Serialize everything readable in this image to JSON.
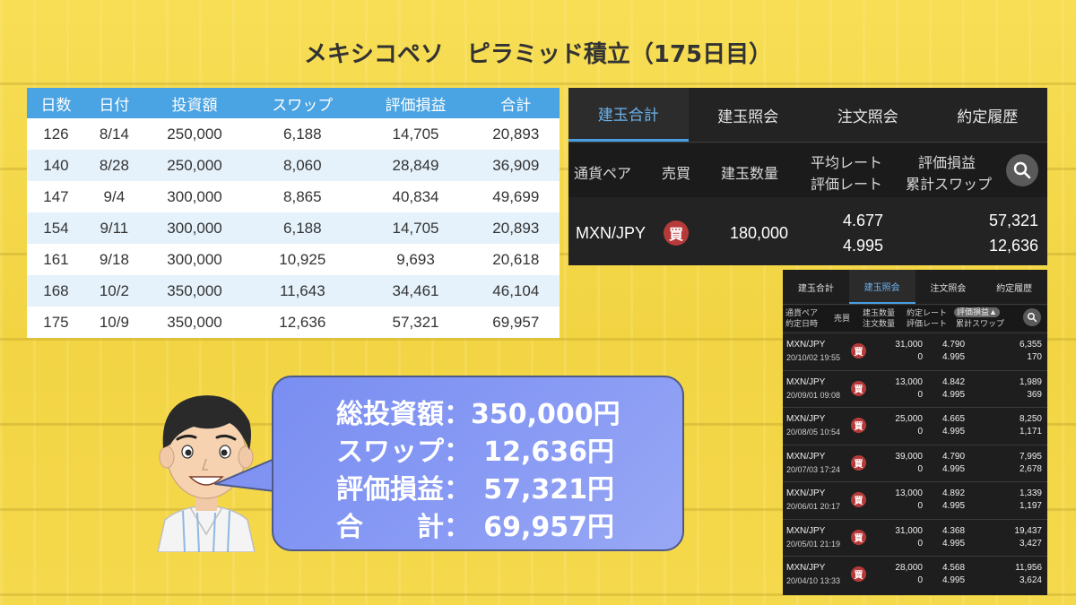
{
  "title": "メキシコペソ　ピラミッド積立（175日目）",
  "summary_table": {
    "headers": [
      "日数",
      "日付",
      "投資額",
      "スワップ",
      "評価損益",
      "合計"
    ],
    "rows": [
      [
        "126",
        "8/14",
        "250,000",
        "6,188",
        "14,705",
        "20,893"
      ],
      [
        "140",
        "8/28",
        "250,000",
        "8,060",
        "28,849",
        "36,909"
      ],
      [
        "147",
        "9/4",
        "300,000",
        "8,865",
        "40,834",
        "49,699"
      ],
      [
        "154",
        "9/11",
        "300,000",
        "6,188",
        "14,705",
        "20,893"
      ],
      [
        "161",
        "9/18",
        "300,000",
        "10,925",
        "9,693",
        "20,618"
      ],
      [
        "168",
        "10/2",
        "350,000",
        "11,643",
        "34,461",
        "46,104"
      ],
      [
        "175",
        "10/9",
        "350,000",
        "12,636",
        "57,321",
        "69,957"
      ]
    ]
  },
  "main_panel": {
    "tabs": [
      "建玉合計",
      "建玉照会",
      "注文照会",
      "約定履歴"
    ],
    "active_tab": 0,
    "headers": {
      "pair": "通貨ペア",
      "side": "売買",
      "qty": "建玉数量",
      "avg_rate": "平均レート",
      "eval_rate": "評価レート",
      "pl": "評価損益",
      "swap": "累計スワップ"
    },
    "row": {
      "pair": "MXN/JPY",
      "side": "買",
      "qty": "180,000",
      "avg_rate": "4.677",
      "eval_rate": "4.995",
      "pl": "57,321",
      "swap": "12,636"
    }
  },
  "detail_panel": {
    "tabs": [
      "建玉合計",
      "建玉照会",
      "注文照会",
      "約定履歴"
    ],
    "active_tab": 1,
    "headers": {
      "pair": "通貨ペア",
      "date": "約定日時",
      "side": "売買",
      "qty": "建玉数量",
      "ord_qty": "注文数量",
      "rate": "約定レート",
      "eval_rate": "評価レート",
      "pl": "評価損益",
      "swap": "累計スワップ"
    },
    "rows": [
      {
        "pair": "MXN/JPY",
        "date": "20/10/02 19:55",
        "side": "買",
        "qty": "31,000",
        "ord": "0",
        "rate": "4.790",
        "eval": "4.995",
        "pl": "6,355",
        "swap": "170"
      },
      {
        "pair": "MXN/JPY",
        "date": "20/09/01 09:08",
        "side": "買",
        "qty": "13,000",
        "ord": "0",
        "rate": "4.842",
        "eval": "4.995",
        "pl": "1,989",
        "swap": "369"
      },
      {
        "pair": "MXN/JPY",
        "date": "20/08/05 10:54",
        "side": "買",
        "qty": "25,000",
        "ord": "0",
        "rate": "4.665",
        "eval": "4.995",
        "pl": "8,250",
        "swap": "1,171"
      },
      {
        "pair": "MXN/JPY",
        "date": "20/07/03 17:24",
        "side": "買",
        "qty": "39,000",
        "ord": "0",
        "rate": "4.790",
        "eval": "4.995",
        "pl": "7,995",
        "swap": "2,678"
      },
      {
        "pair": "MXN/JPY",
        "date": "20/06/01 20:17",
        "side": "買",
        "qty": "13,000",
        "ord": "0",
        "rate": "4.892",
        "eval": "4.995",
        "pl": "1,339",
        "swap": "1,197"
      },
      {
        "pair": "MXN/JPY",
        "date": "20/05/01 21:19",
        "side": "買",
        "qty": "31,000",
        "ord": "0",
        "rate": "4.368",
        "eval": "4.995",
        "pl": "19,437",
        "swap": "3,427"
      },
      {
        "pair": "MXN/JPY",
        "date": "20/04/10 13:33",
        "side": "買",
        "qty": "28,000",
        "ord": "0",
        "rate": "4.568",
        "eval": "4.995",
        "pl": "11,956",
        "swap": "3,624"
      }
    ]
  },
  "speech": {
    "lines": [
      {
        "label": "総投資額：",
        "value": "350,000円"
      },
      {
        "label": "スワップ：",
        "value": "12,636円"
      },
      {
        "label": "評価損益：",
        "value": "57,321円"
      },
      {
        "label": "合　　計：",
        "value": "69,957円"
      }
    ]
  },
  "colors": {
    "background": "#f5d94a",
    "table_header": "#4aa3e2",
    "table_alt_row": "#e5f2fb",
    "panel_bg": "#232323",
    "active_tab": "#6cb4ee",
    "buy_badge": "#b73a3a",
    "bubble": "#8a9cf4"
  }
}
